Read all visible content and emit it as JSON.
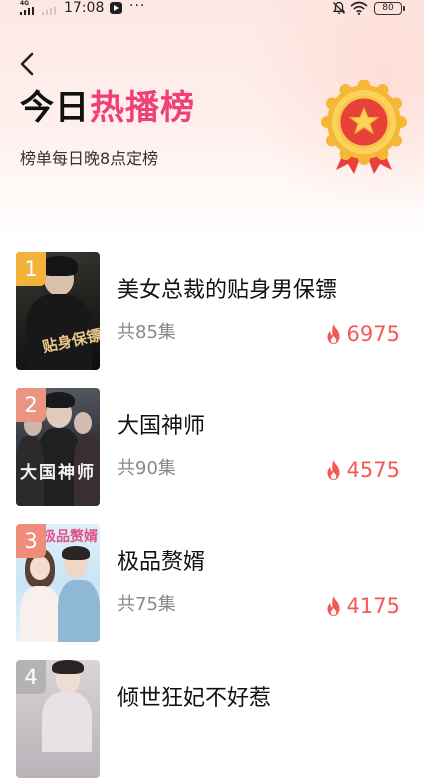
{
  "status_bar": {
    "network": "4G",
    "time": "17:08",
    "dots": "···",
    "battery": "80"
  },
  "header": {
    "title_plain": "今日",
    "title_accent": "热播榜",
    "subtitle": "榜单每日晚8点定榜"
  },
  "colors": {
    "accent": "#f0407a",
    "heat": "#f35a55",
    "rank_1": "#f3b23a",
    "rank_2": "#e99582",
    "rank_3": "#ef8d7a",
    "rank_4": "#b3b3b3"
  },
  "ranking": [
    {
      "rank": "1",
      "title": "美女总裁的贴身男保镖",
      "episodes": "共85集",
      "heat": "6975",
      "cover_text": "贴身保镖"
    },
    {
      "rank": "2",
      "title": "大国神师",
      "episodes": "共90集",
      "heat": "4575",
      "cover_text": "大国神师"
    },
    {
      "rank": "3",
      "title": "极品赘婿",
      "episodes": "共75集",
      "heat": "4175",
      "cover_text": "极品赘婿"
    },
    {
      "rank": "4",
      "title": "倾世狂妃不好惹",
      "episodes": "",
      "heat": "",
      "cover_text": ""
    }
  ]
}
